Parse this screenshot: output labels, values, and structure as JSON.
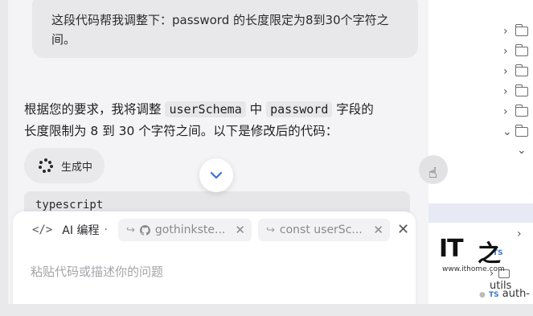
{
  "chat": {
    "user_message_line1": "这段代码帮我调整下：password 的长度限定为8到30个字符之",
    "user_message_line2": "间。",
    "assistant_pre": "根据您的要求，我将调整 ",
    "assistant_code1": "userSchema",
    "assistant_mid": " 中 ",
    "assistant_code2": "password",
    "assistant_post": " 字段的",
    "assistant_line2": "长度限制为 8 到 30 个字符之间。以下是修改后的代码：",
    "generating_label": "生成中",
    "code_language": "typescript"
  },
  "composer": {
    "mode_icon": "</>",
    "mode_label": "AI 编程",
    "separator": "·",
    "chips": [
      {
        "icon": "github-icon",
        "label": "gothinkste..."
      },
      {
        "icon": "code-ref-icon",
        "label": "const userSc..."
      }
    ],
    "placeholder": "粘贴代码或描述你的问题"
  },
  "file_tree": {
    "utils_label": "utils",
    "auth_label": "auth-",
    "ts_badge": "TS"
  },
  "watermark": {
    "logo_text": "IT",
    "logo_glyph": "之",
    "url": "www.ithome.com"
  },
  "colors": {
    "accent_blue": "#3b6fd9",
    "ts_badge": "#3c7ac7",
    "highlight_row": "#e7eaf5"
  }
}
